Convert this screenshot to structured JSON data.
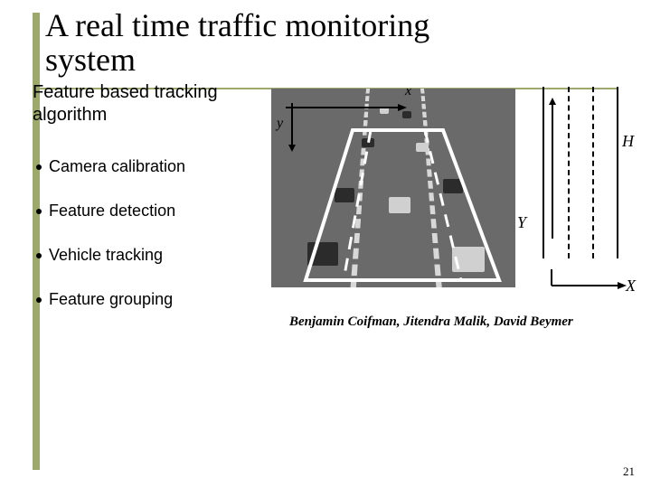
{
  "title": "A real time  traffic monitoring system",
  "subtitle": "Feature based tracking algorithm",
  "bullets": [
    "Camera calibration",
    "Feature detection",
    "Vehicle tracking",
    "Feature grouping"
  ],
  "figure": {
    "image_axes": {
      "x": "x",
      "y": "y"
    },
    "world_axes": {
      "X": "X",
      "Y": "Y",
      "H": "H"
    }
  },
  "caption": "Benjamin Coifman, Jitendra Malik, David Beymer",
  "page_number": "21"
}
